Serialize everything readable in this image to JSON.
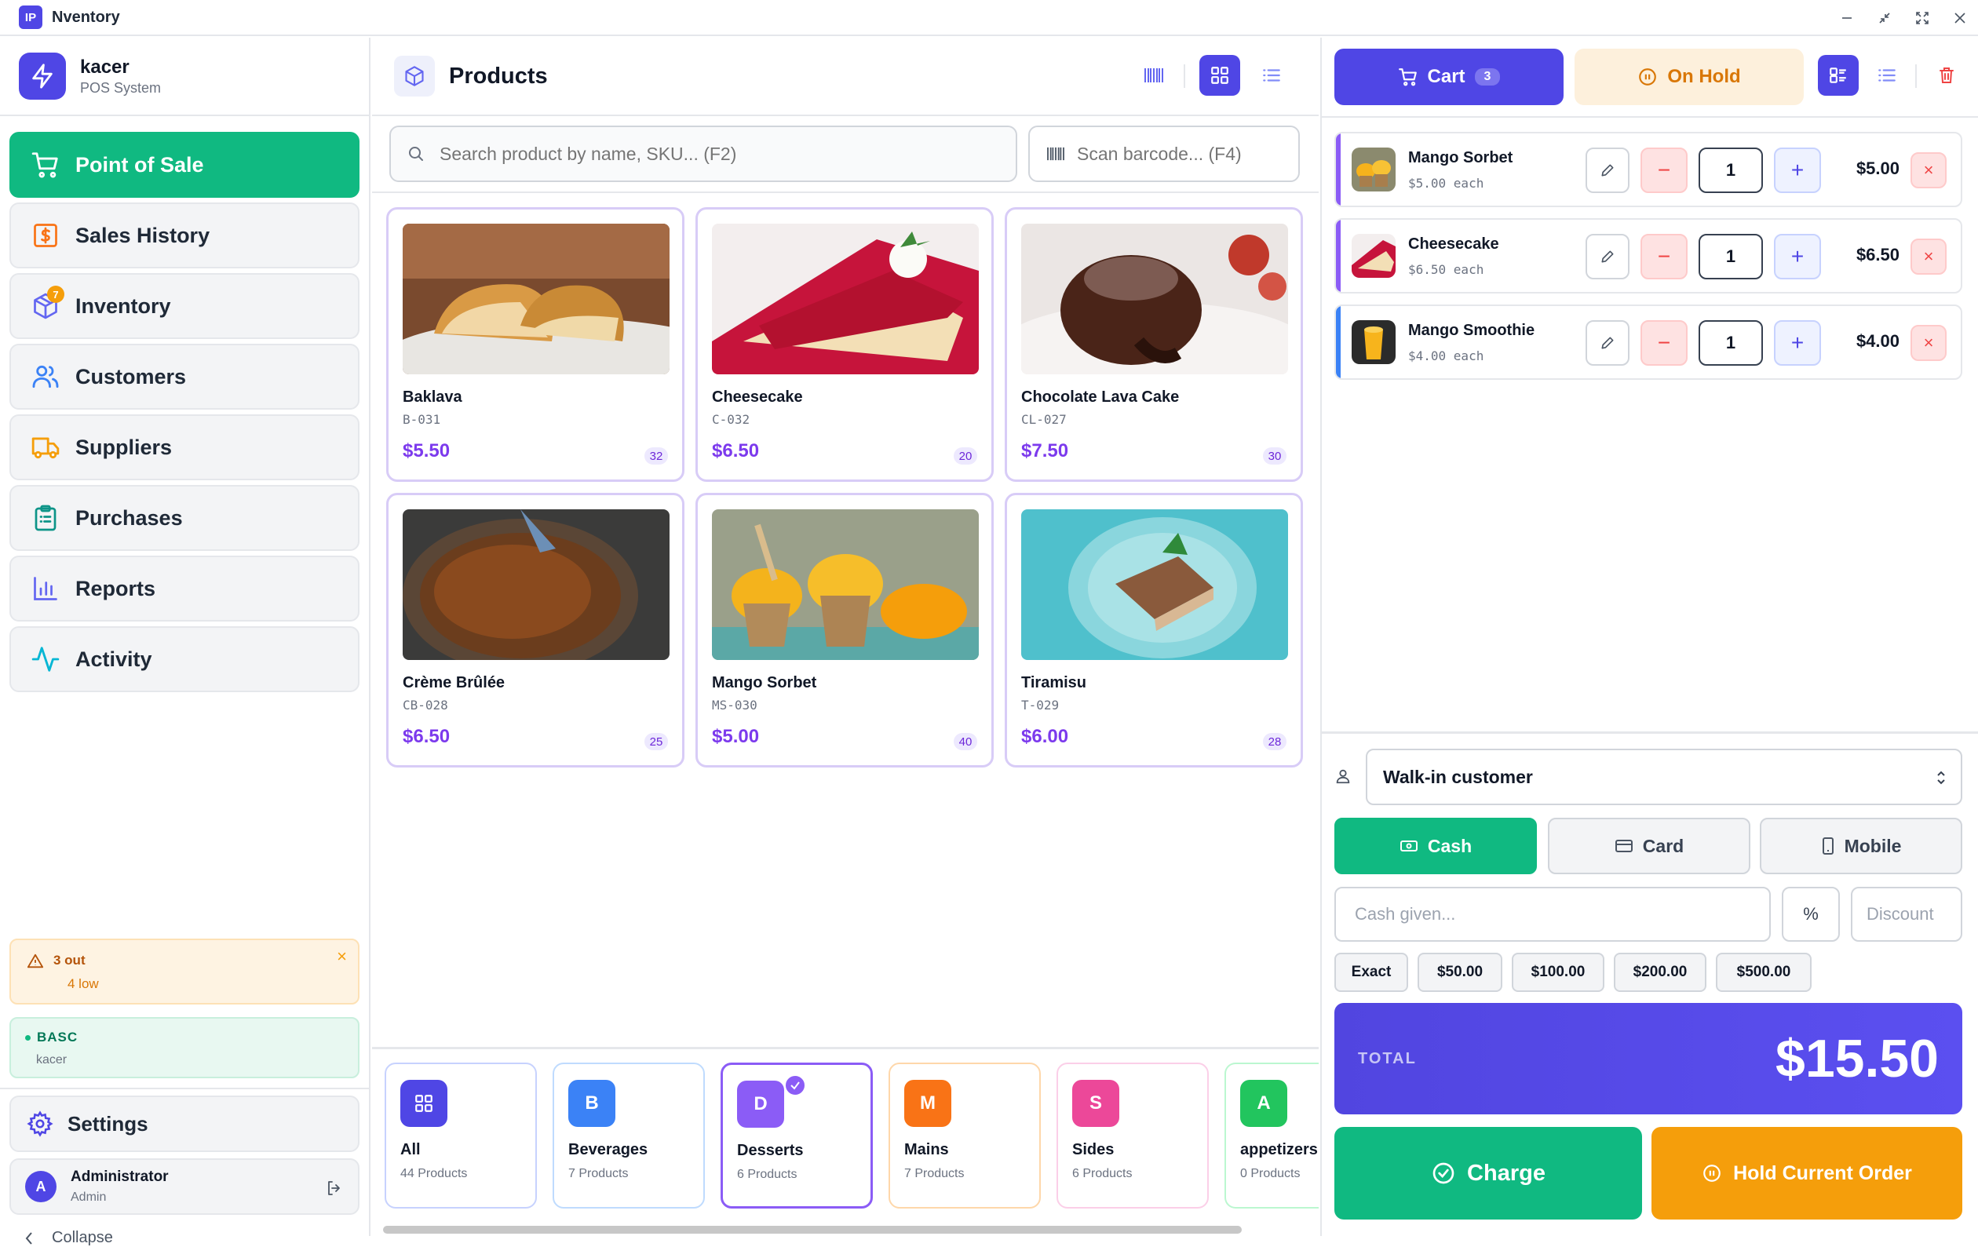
{
  "window": {
    "app_icon": "IP",
    "title": "Nventory"
  },
  "brand": {
    "name": "kacer",
    "subtitle": "POS System"
  },
  "nav": [
    {
      "label": "Point of Sale",
      "icon": "cart-icon",
      "active": true
    },
    {
      "label": "Sales History",
      "icon": "dollar-receipt-icon"
    },
    {
      "label": "Inventory",
      "icon": "box-icon",
      "badge": "7"
    },
    {
      "label": "Customers",
      "icon": "users-icon"
    },
    {
      "label": "Suppliers",
      "icon": "truck-icon"
    },
    {
      "label": "Purchases",
      "icon": "clipboard-icon"
    },
    {
      "label": "Reports",
      "icon": "bar-chart-icon"
    },
    {
      "label": "Activity",
      "icon": "activity-icon"
    }
  ],
  "stock_alert": {
    "title": "3 out",
    "subtitle": "4 low"
  },
  "licence": {
    "code": "BASC",
    "user": "kacer"
  },
  "settings_label": "Settings",
  "user": {
    "avatar": "A",
    "name": "Administrator",
    "role": "Admin"
  },
  "collapse_label": "Collapse",
  "products": {
    "title": "Products",
    "search_placeholder": "Search product by name, SKU... (F2)",
    "barcode_placeholder": "Scan barcode... (F4)",
    "items": [
      {
        "name": "Baklava",
        "sku": "B-031",
        "price": "$5.50",
        "stock": "32"
      },
      {
        "name": "Cheesecake",
        "sku": "C-032",
        "price": "$6.50",
        "stock": "20"
      },
      {
        "name": "Chocolate Lava Cake",
        "sku": "CL-027",
        "price": "$7.50",
        "stock": "30"
      },
      {
        "name": "Crème Brûlée",
        "sku": "CB-028",
        "price": "$6.50",
        "stock": "25"
      },
      {
        "name": "Mango Sorbet",
        "sku": "MS-030",
        "price": "$5.00",
        "stock": "40"
      },
      {
        "name": "Tiramisu",
        "sku": "T-029",
        "price": "$6.00",
        "stock": "28"
      }
    ]
  },
  "categories": [
    {
      "letter": "",
      "name": "All",
      "count": "44 Products",
      "color": "#4f46e5"
    },
    {
      "letter": "B",
      "name": "Beverages",
      "count": "7 Products",
      "color": "#3b82f6"
    },
    {
      "letter": "D",
      "name": "Desserts",
      "count": "6 Products",
      "color": "#8b5cf6",
      "selected": true
    },
    {
      "letter": "M",
      "name": "Mains",
      "count": "7 Products",
      "color": "#f97316"
    },
    {
      "letter": "S",
      "name": "Sides",
      "count": "6 Products",
      "color": "#ec4899"
    },
    {
      "letter": "A",
      "name": "appetizers",
      "count": "0 Products",
      "color": "#22c55e"
    }
  ],
  "cart": {
    "tab_label": "Cart",
    "count": "3",
    "hold_tab_label": "On Hold",
    "items": [
      {
        "name": "Mango Sorbet",
        "unit": "$5.00 each",
        "qty": "1",
        "total": "$5.00",
        "stripe": "#8b5cf6"
      },
      {
        "name": "Cheesecake",
        "unit": "$6.50 each",
        "qty": "1",
        "total": "$6.50",
        "stripe": "#8b5cf6"
      },
      {
        "name": "Mango Smoothie",
        "unit": "$4.00 each",
        "qty": "1",
        "total": "$4.00",
        "stripe": "#3b82f6"
      }
    ]
  },
  "checkout": {
    "customer": "Walk-in customer",
    "payment_methods": [
      "Cash",
      "Card",
      "Mobile"
    ],
    "cash_placeholder": "Cash given...",
    "percent_label": "%",
    "discount_placeholder": "Discount",
    "quick_amounts": [
      "Exact",
      "$50.00",
      "$100.00",
      "$200.00",
      "$500.00"
    ],
    "total_label": "TOTAL",
    "total_value": "$15.50",
    "charge_label": "Charge",
    "hold_label": "Hold Current Order"
  }
}
